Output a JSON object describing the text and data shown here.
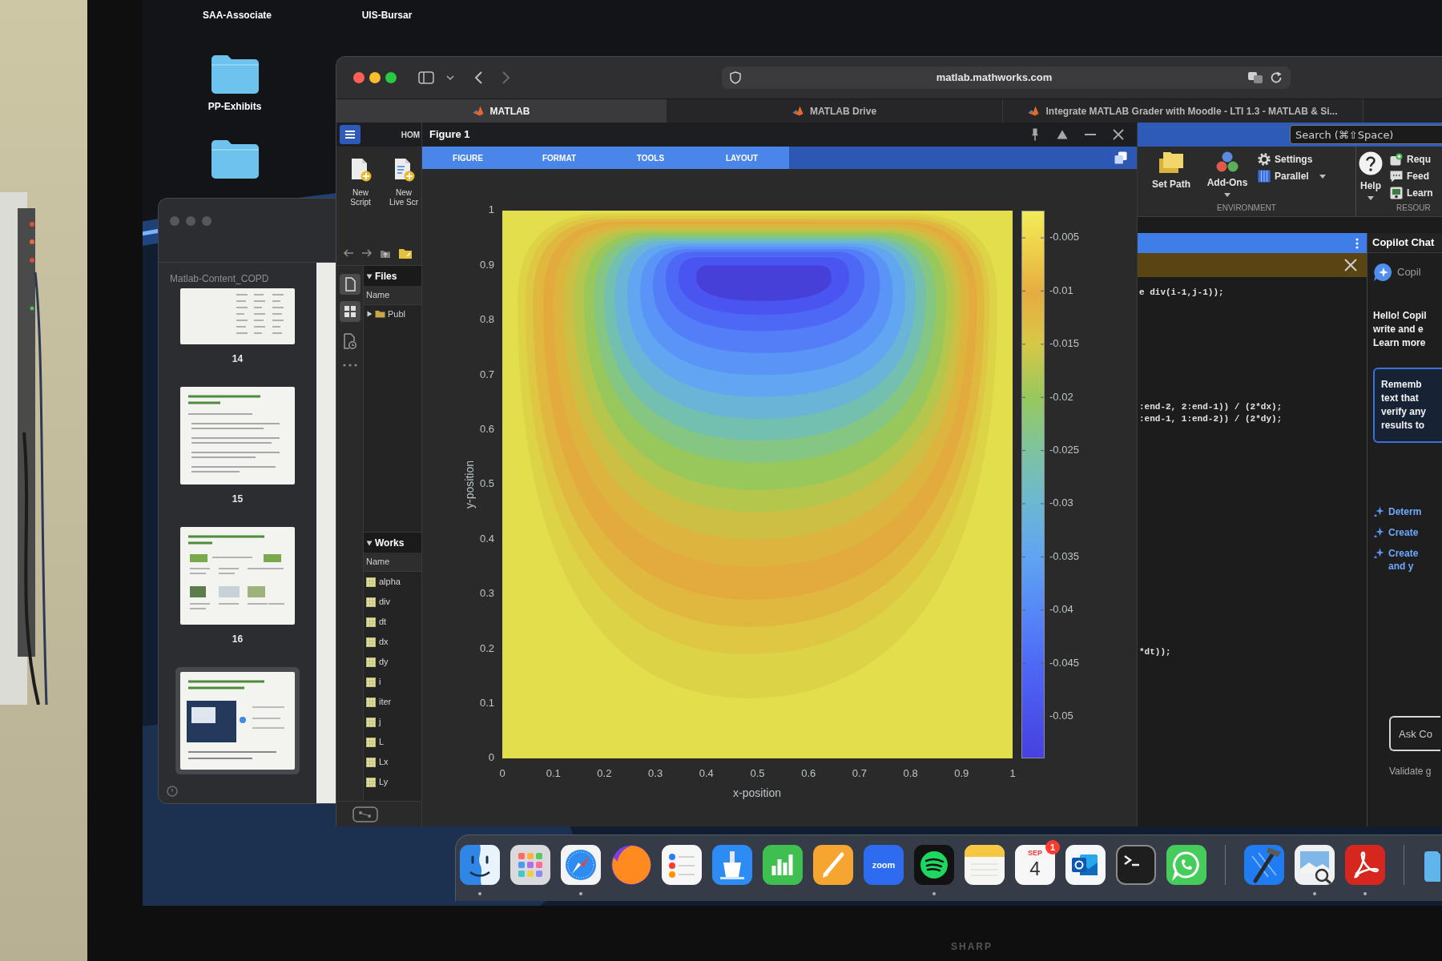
{
  "desktop": {
    "items": [
      {
        "kind": "label",
        "label": "SAA-Associate"
      },
      {
        "kind": "label",
        "label": "UIS-Bursar"
      },
      {
        "kind": "folder",
        "label": "PP-Exhibits"
      },
      {
        "kind": "folder"
      }
    ]
  },
  "slides_window": {
    "title": "Matlab-Content_COPD",
    "slides": [
      {
        "kind": "table",
        "number": "14",
        "selected": false
      },
      {
        "kind": "text",
        "number": "15",
        "selected": false
      },
      {
        "kind": "diagram",
        "number": "16",
        "selected": false
      },
      {
        "kind": "screenshot",
        "selected": true
      }
    ]
  },
  "browser": {
    "address": "matlab.mathworks.com",
    "tabs": [
      {
        "title": "MATLAB",
        "selected": true
      },
      {
        "title": "MATLAB Drive",
        "selected": false
      },
      {
        "title": "Integrate MATLAB Grader with Moodle - LTI 1.3 - MATLAB & Si...",
        "selected": false
      }
    ]
  },
  "matlab": {
    "home_tab": "HOM",
    "new_buttons": [
      "New Script",
      "New Live Scr"
    ],
    "files_panel": {
      "title": "Files",
      "expanded": true,
      "column": "Name",
      "rows": [
        {
          "name": "Publ",
          "expanded": false
        }
      ]
    },
    "workspace_panel": {
      "title": "Works",
      "expanded": true,
      "column": "Name",
      "variables": [
        "alpha",
        "div",
        "dt",
        "dx",
        "dy",
        "i",
        "iter",
        "j",
        "L",
        "Lx",
        "Ly"
      ]
    },
    "figure": {
      "title": "Figure 1",
      "tabs": [
        "FIGURE",
        "FORMAT",
        "TOOLS",
        "LAYOUT"
      ],
      "plot": {
        "xlabel": "x-position",
        "ylabel": "y-position",
        "xticks": [
          "0",
          "0.1",
          "0.2",
          "0.3",
          "0.4",
          "0.5",
          "0.6",
          "0.7",
          "0.8",
          "0.9",
          "1"
        ],
        "yticks": [
          "1",
          "0.9",
          "0.8",
          "0.7",
          "0.6",
          "0.5",
          "0.4",
          "0.3",
          "0.2",
          "0.1",
          "0"
        ],
        "colorbar_ticks": [
          "-0.005",
          "-0.01",
          "-0.015",
          "-0.02",
          "-0.025",
          "-0.03",
          "-0.035",
          "-0.04",
          "-0.045",
          "-0.05"
        ]
      }
    },
    "toolstrip": {
      "search_placeholder": "Search (⌘⇧Space)",
      "groups": [
        {
          "label": "ENVIRONMENT",
          "buttons": [
            {
              "kind": "large",
              "label": "Set Path",
              "menu": false
            },
            {
              "kind": "large",
              "label": "Add-Ons",
              "menu": true
            },
            {
              "kind": "small",
              "label": "Settings",
              "menu": false
            },
            {
              "kind": "small",
              "label": "Parallel",
              "menu": true
            }
          ]
        },
        {
          "label": "RESOUR",
          "buttons": [
            {
              "kind": "large",
              "label": "Help",
              "menu": true
            },
            {
              "kind": "small",
              "label": "Requ",
              "menu": false
            },
            {
              "kind": "small",
              "label": "Feed",
              "menu": false
            },
            {
              "kind": "small",
              "label": "Learn",
              "menu": false
            }
          ]
        }
      ]
    },
    "editor": {
      "code_blocks": [
        {
          "lines": [
            "e div(i-1,j-1));"
          ]
        },
        {
          "lines": [
            ":end-2, 2:end-1)) / (2*dx);",
            ":end-1, 1:end-2)) / (2*dy);"
          ]
        },
        {
          "lines": [
            "*dt));"
          ]
        }
      ]
    },
    "copilot": {
      "title": "Copilot Chat",
      "assistant": "Copil",
      "intro_lines": [
        "Hello! Copil",
        "write and e",
        "Learn more"
      ],
      "note_lines": [
        "Rememb",
        "text that",
        "verify any",
        "results to"
      ],
      "suggestions": [
        {
          "lines": [
            "Determ"
          ]
        },
        {
          "lines": [
            "Create"
          ]
        },
        {
          "lines": [
            "Create",
            "and y"
          ]
        }
      ],
      "input_placeholder": "Ask Co",
      "footer": "Validate g"
    }
  },
  "dock": {
    "apps": [
      {
        "kind": "face",
        "running": true
      },
      {
        "kind": "grid",
        "running": false
      },
      {
        "kind": "compass",
        "running": true
      },
      {
        "kind": "globe",
        "running": false
      },
      {
        "kind": "checklist",
        "running": false
      },
      {
        "kind": "podium",
        "running": false
      },
      {
        "kind": "chart",
        "running": false
      },
      {
        "kind": "pencil",
        "running": false
      },
      {
        "kind": "wordmark",
        "text": "zoom",
        "running": false
      },
      {
        "kind": "waves",
        "running": true
      },
      {
        "kind": "notepad",
        "running": false
      },
      {
        "kind": "calendar",
        "month": "SEP",
        "day": "4",
        "badge": "1",
        "running": false
      },
      {
        "kind": "mail",
        "running": false
      },
      {
        "kind": "terminal",
        "running": false
      },
      {
        "kind": "chat",
        "running": false
      },
      {
        "kind": "separator"
      },
      {
        "kind": "hammer",
        "running": false
      },
      {
        "kind": "photo",
        "running": true
      },
      {
        "kind": "document",
        "running": true
      },
      {
        "kind": "separator"
      },
      {
        "kind": "folder"
      }
    ]
  },
  "monitor": {
    "brand": "SHARP"
  }
}
